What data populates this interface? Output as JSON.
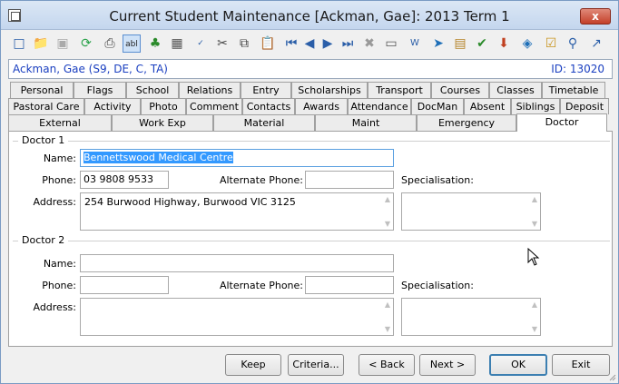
{
  "window": {
    "title": "Current Student Maintenance  [Ackman, Gae]:  2013 Term 1",
    "close_label": "x"
  },
  "toolbar": {
    "icons": [
      "new-icon",
      "open-icon",
      "save-icon",
      "refresh-icon",
      "print-icon",
      "text-field-icon",
      "tree-icon",
      "calculator-icon",
      "spellcheck-icon",
      "cut-icon",
      "copy-icon",
      "paste-icon",
      "first-record-icon",
      "previous-record-icon",
      "next-record-icon",
      "last-record-icon",
      "delete-icon",
      "card-icon",
      "word-icon",
      "send-icon",
      "clipboard-icon",
      "approve-icon",
      "download-icon",
      "tag-icon",
      "checklist-icon",
      "pin-icon",
      "arrow-up-right-icon"
    ]
  },
  "student": {
    "name": "Ackman, Gae (S9, DE, C, TA)",
    "id": "ID: 13020"
  },
  "tabs": {
    "row1": [
      "Personal",
      "Flags",
      "School",
      "Relations",
      "Entry",
      "Scholarships",
      "Transport",
      "Courses",
      "Classes",
      "Timetable"
    ],
    "row2": [
      "Pastoral Care",
      "Activity",
      "Photo",
      "Comment",
      "Contacts",
      "Awards",
      "Attendance",
      "DocMan",
      "Absent",
      "Siblings",
      "Deposit"
    ],
    "row3": [
      "External",
      "Work Exp",
      "Material",
      "Maint",
      "Emergency",
      "Doctor"
    ],
    "selected": "Doctor"
  },
  "doctor1": {
    "title": "Doctor 1",
    "name_label": "Name:",
    "name": "Bennettswood Medical Centre",
    "phone_label": "Phone:",
    "phone": "03 9808 9533",
    "alt_phone_label": "Alternate Phone:",
    "alt_phone": "",
    "specialisation_label": "Specialisation:",
    "specialisation": "",
    "address_label": "Address:",
    "address": "254 Burwood Highway, Burwood VIC 3125"
  },
  "doctor2": {
    "title": "Doctor 2",
    "name_label": "Name:",
    "name": "",
    "phone_label": "Phone:",
    "phone": "",
    "alt_phone_label": "Alternate Phone:",
    "alt_phone": "",
    "specialisation_label": "Specialisation:",
    "specialisation": "",
    "address_label": "Address:",
    "address": ""
  },
  "buttons": {
    "keep": "Keep",
    "criteria": "Criteria...",
    "back": "< Back",
    "next": "Next >",
    "ok": "OK",
    "exit": "Exit"
  }
}
